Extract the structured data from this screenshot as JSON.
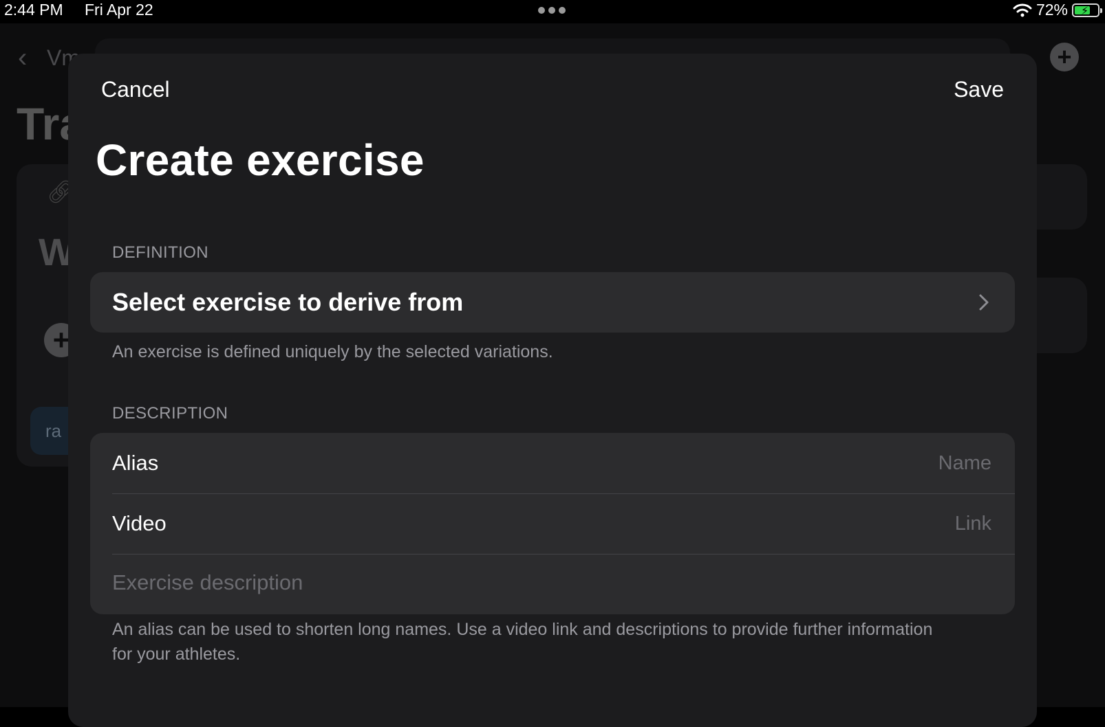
{
  "status_bar": {
    "time": "2:44 PM",
    "date": "Fri Apr 22",
    "battery": "72%",
    "battery_level": 0.72
  },
  "background": {
    "back_label": "Vm",
    "title": "Tra",
    "card_letter": "W",
    "chip_label": "ra"
  },
  "modal": {
    "cancel_label": "Cancel",
    "save_label": "Save",
    "title": "Create exercise",
    "definition": {
      "header": "DEFINITION",
      "select_label": "Select exercise to derive from",
      "footer": "An exercise is defined uniquely by the selected variations."
    },
    "description": {
      "header": "DESCRIPTION",
      "alias_label": "Alias",
      "alias_placeholder": "Name",
      "video_label": "Video",
      "video_placeholder": "Link",
      "description_placeholder": "Exercise description",
      "footer": "An alias can be used to shorten long names. Use a video link and descriptions to provide further information for your athletes."
    }
  },
  "colors": {
    "sheet_background": "#1c1c1e",
    "row_background": "#2c2c2e",
    "secondary_text": "#9a9aa0",
    "placeholder_text": "#6b6b70",
    "battery_green": "#32d74b"
  }
}
